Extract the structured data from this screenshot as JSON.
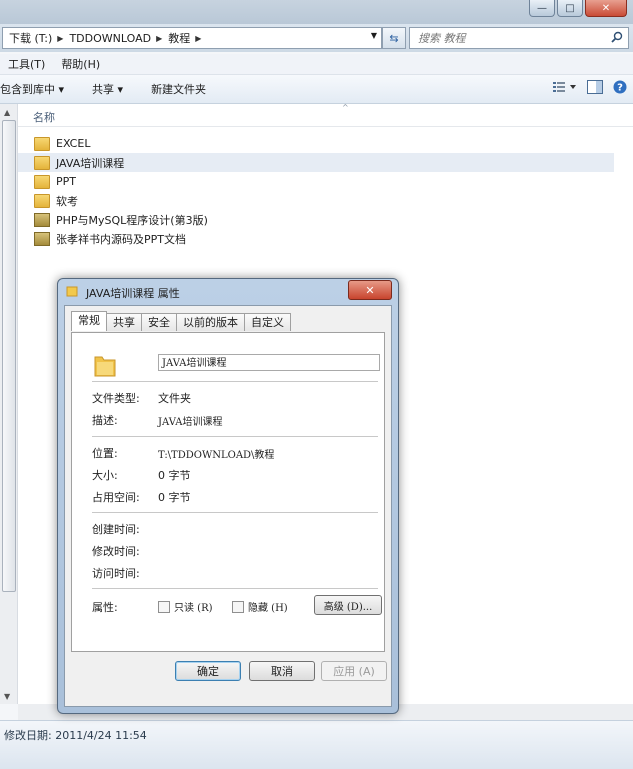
{
  "window": {
    "controls": [
      "—",
      "□",
      "✕"
    ]
  },
  "address": {
    "crumbs": [
      "下载 (T:)",
      "TDDOWNLOAD",
      "教程"
    ],
    "search_placeholder": "搜索 教程"
  },
  "menu": [
    "工具(T)",
    "帮助(H)"
  ],
  "toolbar": {
    "include": "包含到库中 ▾",
    "share": "共享 ▾",
    "new_folder": "新建文件夹"
  },
  "list": {
    "column": "名称",
    "items": [
      {
        "name": "EXCEL",
        "icon": "folder-icon"
      },
      {
        "name": "JAVA培训课程",
        "icon": "folder-icon"
      },
      {
        "name": "PPT",
        "icon": "folder-icon"
      },
      {
        "name": "软考",
        "icon": "folder-icon"
      },
      {
        "name": "PHP与MySQL程序设计(第3版)",
        "icon": "book-icon"
      },
      {
        "name": "张孝祥书内源码及PPT文档",
        "icon": "book-icon"
      }
    ]
  },
  "status": {
    "modified": "修改日期: 2011/4/24 11:54"
  },
  "dialog": {
    "title": "JAVA培训课程 属性",
    "close": "✕",
    "tabs": [
      "常规",
      "共享",
      "安全",
      "以前的版本",
      "自定义"
    ],
    "name_value": "JAVA培训课程",
    "rows": {
      "type_label": "文件类型:",
      "type_value": "文件夹",
      "desc_label": "描述:",
      "desc_value": "JAVA培训课程",
      "location_label": "位置:",
      "location_value": "T:\\TDDOWNLOAD\\教程",
      "size_label": "大小:",
      "size_value": "0 字节",
      "ondisk_label": "占用空间:",
      "ondisk_value": "0 字节",
      "created_label": "创建时间:",
      "modified_label": "修改时间:",
      "accessed_label": "访问时间:",
      "attr_label": "属性:"
    },
    "readonly": "只读 (R)",
    "hidden": "隐藏 (H)",
    "advanced": "高级 (D)...",
    "ok": "确定",
    "cancel": "取消",
    "apply": "应用 (A)"
  }
}
